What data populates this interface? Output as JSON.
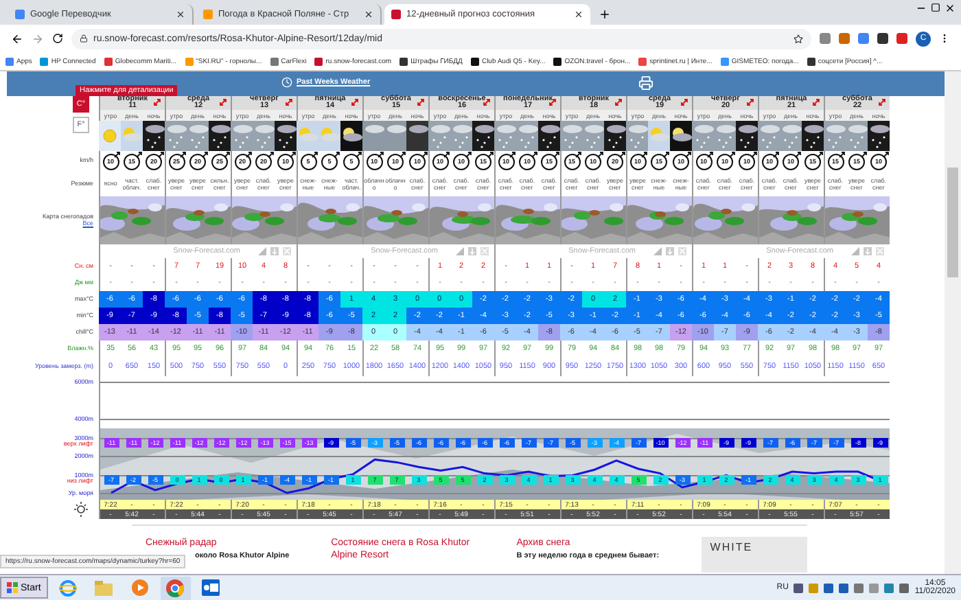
{
  "browser": {
    "tabs": [
      {
        "title": "Google Переводчик",
        "selected": false
      },
      {
        "title": "Погода в Красной Поляне - Стр",
        "selected": false
      },
      {
        "title": "12-дневный прогноз состояния",
        "selected": true
      }
    ],
    "url": "ru.snow-forecast.com/resorts/Rosa-Khutor-Alpine-Resort/12day/mid",
    "profile": "C",
    "bookmarks": [
      "Apps",
      "HP Connected",
      "Globecomm Mariti...",
      "\"SKI.RU\" - горнолы...",
      "CarFlexi",
      "ru.snow-forecast.com",
      "Штрафы ГИБДД",
      "Club Audi Q5 - Key...",
      "OZON.travel - брон...",
      "sprintinet.ru | Инте...",
      "GISMETEO: погода...",
      "соцсети [Россия] ^..."
    ]
  },
  "header": {
    "tooltip": "Нажмите для детализации",
    "past_weather_link": "Past Weeks Weather"
  },
  "units": [
    {
      "label": "C°",
      "selected": true
    },
    {
      "label": "F°",
      "selected": false
    }
  ],
  "row_labels": {
    "wind": "km/h",
    "summary": "Резюме",
    "maps": "Карта снегопадов",
    "maps_link": "Все",
    "snow": "Сн. см",
    "rain": "Дж мм",
    "max": "max°C",
    "min": "min°C",
    "chill": "chill°C",
    "humidity": "Влажн.%",
    "freezing": "Уровень замерз. (m)"
  },
  "strips": [
    "Snow-Forecast.com",
    "Snow-Forecast.com",
    "Snow-Forecast.com",
    "Snow-Forecast.com"
  ],
  "days": [
    {
      "name": "вторник",
      "date": "11",
      "sunrise": [
        "7:22",
        "-",
        "-"
      ],
      "sunset": [
        "-",
        "5:42",
        "-"
      ],
      "columns": [
        {
          "period": "утро",
          "kind": "sun",
          "wind": "10",
          "summary": "ясно",
          "snow": "-",
          "rain": "-",
          "max": "-6",
          "min": "-9",
          "chill": "-13",
          "humidity": "35",
          "freezing": "0",
          "top_lift": "-11",
          "bottom_lift": "-7"
        },
        {
          "period": "день",
          "kind": "part_sun",
          "wind": "15",
          "summary": "част. облач.",
          "snow": "-",
          "rain": "-",
          "max": "-6",
          "min": "-7",
          "chill": "-11",
          "humidity": "56",
          "freezing": "650",
          "top_lift": "-11",
          "bottom_lift": "-2"
        },
        {
          "period": "ночь",
          "kind": "night_snow",
          "wind": "20",
          "summary": "слаб. снег",
          "snow": "-",
          "rain": "-",
          "max": "-8",
          "min": "-9",
          "chill": "-14",
          "humidity": "43",
          "freezing": "150",
          "top_lift": "-12",
          "bottom_lift": "-5"
        }
      ]
    },
    {
      "name": "среда",
      "date": "12",
      "sunrise": [
        "7:22",
        "-",
        "-"
      ],
      "sunset": [
        "-",
        "5:44",
        "-"
      ],
      "columns": [
        {
          "period": "утро",
          "kind": "snow",
          "wind": "25",
          "summary": "увере снег",
          "snow": "7",
          "rain": "-",
          "max": "-6",
          "min": "-8",
          "chill": "-12",
          "humidity": "95",
          "freezing": "500",
          "top_lift": "-11",
          "bottom_lift": "0"
        },
        {
          "period": "день",
          "kind": "snow",
          "wind": "20",
          "summary": "увере снег",
          "snow": "7",
          "rain": "-",
          "max": "-6",
          "min": "-5",
          "chill": "-11",
          "humidity": "95",
          "freezing": "750",
          "top_lift": "-12",
          "bottom_lift": "1"
        },
        {
          "period": "ночь",
          "kind": "night_snow",
          "wind": "25",
          "summary": "сильн. снег",
          "snow": "19",
          "rain": "-",
          "max": "-6",
          "min": "-8",
          "chill": "-11",
          "humidity": "96",
          "freezing": "550",
          "top_lift": "-12",
          "bottom_lift": "0"
        }
      ]
    },
    {
      "name": "четверг",
      "date": "13",
      "sunrise": [
        "7:20",
        "-",
        "-"
      ],
      "sunset": [
        "-",
        "5:45",
        "-"
      ],
      "columns": [
        {
          "period": "утро",
          "kind": "snow",
          "wind": "20",
          "summary": "увере снег",
          "snow": "10",
          "rain": "-",
          "max": "-6",
          "min": "-5",
          "chill": "-10",
          "humidity": "97",
          "freezing": "750",
          "top_lift": "-12",
          "bottom_lift": "1"
        },
        {
          "period": "день",
          "kind": "snow",
          "wind": "20",
          "summary": "слаб. снег",
          "snow": "4",
          "rain": "-",
          "max": "-8",
          "min": "-7",
          "chill": "-11",
          "humidity": "84",
          "freezing": "550",
          "top_lift": "-13",
          "bottom_lift": "-1"
        },
        {
          "period": "ночь",
          "kind": "night_snow",
          "wind": "10",
          "summary": "увере снег",
          "snow": "8",
          "rain": "-",
          "max": "-8",
          "min": "-9",
          "chill": "-12",
          "humidity": "94",
          "freezing": "0",
          "top_lift": "-15",
          "bottom_lift": "-4"
        }
      ]
    },
    {
      "name": "пятница",
      "date": "14",
      "sunrise": [
        "7:18",
        "-",
        "-"
      ],
      "sunset": [
        "-",
        "5:45",
        "-"
      ],
      "columns": [
        {
          "period": "утро",
          "kind": "part_sun",
          "wind": "5",
          "summary": "снеж- ные",
          "snow": "-",
          "rain": "-",
          "max": "-8",
          "min": "-8",
          "chill": "-11",
          "humidity": "94",
          "freezing": "250",
          "top_lift": "-13",
          "bottom_lift": "-1"
        },
        {
          "period": "день",
          "kind": "part_sun",
          "wind": "5",
          "summary": "снеж- ные",
          "snow": "-",
          "rain": "-",
          "max": "-6",
          "min": "-6",
          "chill": "-9",
          "humidity": "76",
          "freezing": "750",
          "top_lift": "-9",
          "bottom_lift": "-1"
        },
        {
          "period": "ночь",
          "kind": "night_moon",
          "wind": "5",
          "summary": "част. облач.",
          "snow": "-",
          "rain": "-",
          "max": "1",
          "min": "-5",
          "chill": "-8",
          "humidity": "15",
          "freezing": "1000",
          "top_lift": "-5",
          "bottom_lift": "1"
        }
      ]
    },
    {
      "name": "суббота",
      "date": "15",
      "sunrise": [
        "7:18",
        "-",
        "-"
      ],
      "sunset": [
        "-",
        "5:47",
        "-"
      ],
      "columns": [
        {
          "period": "утро",
          "kind": "overcast",
          "wind": "10",
          "summary": "облачн о",
          "snow": "-",
          "rain": "-",
          "max": "4",
          "min": "2",
          "chill": "0",
          "humidity": "22",
          "freezing": "1800",
          "top_lift": "-3",
          "bottom_lift": "7"
        },
        {
          "period": "день",
          "kind": "overcast",
          "wind": "10",
          "summary": "облачн о",
          "snow": "-",
          "rain": "-",
          "max": "3",
          "min": "2",
          "chill": "0",
          "humidity": "58",
          "freezing": "1650",
          "top_lift": "-5",
          "bottom_lift": "7"
        },
        {
          "period": "ночь",
          "kind": "night_overcast",
          "wind": "10",
          "summary": "слаб. снег",
          "snow": "-",
          "rain": "-",
          "max": "0",
          "min": "-2",
          "chill": "-4",
          "humidity": "74",
          "freezing": "1400",
          "top_lift": "-6",
          "bottom_lift": "3"
        }
      ]
    },
    {
      "name": "воскресенье",
      "date": "16",
      "sunrise": [
        "7:16",
        "-",
        "-"
      ],
      "sunset": [
        "-",
        "5:49",
        "-"
      ],
      "columns": [
        {
          "period": "утро",
          "kind": "snow",
          "wind": "10",
          "summary": "слаб. снег",
          "snow": "1",
          "rain": "-",
          "max": "0",
          "min": "-2",
          "chill": "-4",
          "humidity": "95",
          "freezing": "1200",
          "top_lift": "-6",
          "bottom_lift": "5"
        },
        {
          "period": "день",
          "kind": "snow",
          "wind": "10",
          "summary": "слаб. снег",
          "snow": "2",
          "rain": "-",
          "max": "0",
          "min": "-1",
          "chill": "-1",
          "humidity": "99",
          "freezing": "1400",
          "top_lift": "-6",
          "bottom_lift": "5"
        },
        {
          "period": "ночь",
          "kind": "night_snow",
          "wind": "15",
          "summary": "слаб. снег",
          "snow": "2",
          "rain": "-",
          "max": "-2",
          "min": "-4",
          "chill": "-6",
          "humidity": "97",
          "freezing": "1050",
          "top_lift": "-6",
          "bottom_lift": "2"
        }
      ]
    },
    {
      "name": "понедельник",
      "date": "17",
      "sunrise": [
        "7:15",
        "-",
        "-"
      ],
      "sunset": [
        "-",
        "5:51",
        "-"
      ],
      "columns": [
        {
          "period": "утро",
          "kind": "snow",
          "wind": "10",
          "summary": "слаб. снег",
          "snow": "-",
          "rain": "-",
          "max": "-2",
          "min": "-3",
          "chill": "-5",
          "humidity": "92",
          "freezing": "950",
          "top_lift": "-6",
          "bottom_lift": "3"
        },
        {
          "period": "день",
          "kind": "snow",
          "wind": "10",
          "summary": "слаб. снег",
          "snow": "1",
          "rain": "-",
          "max": "-2",
          "min": "-2",
          "chill": "-4",
          "humidity": "97",
          "freezing": "1150",
          "top_lift": "-7",
          "bottom_lift": "4"
        },
        {
          "period": "ночь",
          "kind": "night_snow",
          "wind": "15",
          "summary": "слаб. снег",
          "snow": "1",
          "rain": "-",
          "max": "-3",
          "min": "-5",
          "chill": "-8",
          "humidity": "99",
          "freezing": "900",
          "top_lift": "-7",
          "bottom_lift": "1"
        }
      ]
    },
    {
      "name": "вторник",
      "date": "18",
      "sunrise": [
        "7:13",
        "-",
        "-"
      ],
      "sunset": [
        "-",
        "5:52",
        "-"
      ],
      "columns": [
        {
          "period": "утро",
          "kind": "snow",
          "wind": "15",
          "summary": "слаб. снег",
          "snow": "-",
          "rain": "-",
          "max": "-2",
          "min": "-3",
          "chill": "-6",
          "humidity": "79",
          "freezing": "950",
          "top_lift": "-5",
          "bottom_lift": "3"
        },
        {
          "period": "день",
          "kind": "snow",
          "wind": "10",
          "summary": "слаб. снег",
          "snow": "1",
          "rain": "-",
          "max": "0",
          "min": "-1",
          "chill": "-4",
          "humidity": "94",
          "freezing": "1250",
          "top_lift": "-3",
          "bottom_lift": "4"
        },
        {
          "period": "ночь",
          "kind": "night_snow",
          "wind": "20",
          "summary": "увере снег",
          "snow": "7",
          "rain": "-",
          "max": "2",
          "min": "-2",
          "chill": "-6",
          "humidity": "84",
          "freezing": "1750",
          "top_lift": "-4",
          "bottom_lift": "4"
        }
      ]
    },
    {
      "name": "среда",
      "date": "19",
      "sunrise": [
        "7:11",
        "-",
        "-"
      ],
      "sunset": [
        "-",
        "5:52",
        "-"
      ],
      "columns": [
        {
          "period": "утро",
          "kind": "snow",
          "wind": "10",
          "summary": "увере снег",
          "snow": "8",
          "rain": "-",
          "max": "-1",
          "min": "-1",
          "chill": "-5",
          "humidity": "98",
          "freezing": "1300",
          "top_lift": "-7",
          "bottom_lift": "5"
        },
        {
          "period": "день",
          "kind": "part_sun",
          "wind": "15",
          "summary": "снеж- ные",
          "snow": "1",
          "rain": "-",
          "max": "-3",
          "min": "-4",
          "chill": "-7",
          "humidity": "98",
          "freezing": "1050",
          "top_lift": "-10",
          "bottom_lift": "2"
        },
        {
          "period": "ночь",
          "kind": "night_moon",
          "wind": "10",
          "summary": "снеж- ные",
          "snow": "-",
          "rain": "-",
          "max": "-6",
          "min": "-6",
          "chill": "-12",
          "humidity": "79",
          "freezing": "300",
          "top_lift": "-12",
          "bottom_lift": "-3"
        }
      ]
    },
    {
      "name": "четверг",
      "date": "20",
      "sunrise": [
        "7:09",
        "-",
        "-"
      ],
      "sunset": [
        "-",
        "5:54",
        "-"
      ],
      "columns": [
        {
          "period": "утро",
          "kind": "snow",
          "wind": "10",
          "summary": "слаб. снег",
          "snow": "1",
          "rain": "-",
          "max": "-4",
          "min": "-6",
          "chill": "-10",
          "humidity": "94",
          "freezing": "600",
          "top_lift": "-11",
          "bottom_lift": "1"
        },
        {
          "period": "день",
          "kind": "snow",
          "wind": "10",
          "summary": "слаб. снег",
          "snow": "1",
          "rain": "-",
          "max": "-3",
          "min": "-4",
          "chill": "-7",
          "humidity": "93",
          "freezing": "950",
          "top_lift": "-9",
          "bottom_lift": "2"
        },
        {
          "period": "ночь",
          "kind": "night_snow",
          "wind": "10",
          "summary": "слаб. снег",
          "snow": "-",
          "rain": "-",
          "max": "-4",
          "min": "-6",
          "chill": "-9",
          "humidity": "77",
          "freezing": "550",
          "top_lift": "-9",
          "bottom_lift": "-1"
        }
      ]
    },
    {
      "name": "пятница",
      "date": "21",
      "sunrise": [
        "7:09",
        "-",
        "-"
      ],
      "sunset": [
        "-",
        "5:55",
        "-"
      ],
      "columns": [
        {
          "period": "утро",
          "kind": "snow",
          "wind": "10",
          "summary": "слаб. снег",
          "snow": "2",
          "rain": "-",
          "max": "-3",
          "min": "-4",
          "chill": "-6",
          "humidity": "92",
          "freezing": "750",
          "top_lift": "-7",
          "bottom_lift": "2"
        },
        {
          "period": "день",
          "kind": "snow",
          "wind": "10",
          "summary": "слаб. снег",
          "snow": "3",
          "rain": "-",
          "max": "-1",
          "min": "-2",
          "chill": "-2",
          "humidity": "97",
          "freezing": "1150",
          "top_lift": "-6",
          "bottom_lift": "4"
        },
        {
          "period": "ночь",
          "kind": "night_snow",
          "wind": "15",
          "summary": "увере снег",
          "snow": "8",
          "rain": "-",
          "max": "-2",
          "min": "-2",
          "chill": "-4",
          "humidity": "98",
          "freezing": "1050",
          "top_lift": "-7",
          "bottom_lift": "3"
        }
      ]
    },
    {
      "name": "суббота",
      "date": "22",
      "sunrise": [
        "7:07",
        "-",
        "-"
      ],
      "sunset": [
        "-",
        "5:57",
        "-"
      ],
      "columns": [
        {
          "period": "утро",
          "kind": "snow",
          "wind": "15",
          "summary": "слаб. снег",
          "snow": "4",
          "rain": "-",
          "max": "-2",
          "min": "-2",
          "chill": "-4",
          "humidity": "98",
          "freezing": "1150",
          "top_lift": "-7",
          "bottom_lift": "4"
        },
        {
          "period": "день",
          "kind": "snow",
          "wind": "15",
          "summary": "увере снег",
          "snow": "5",
          "rain": "-",
          "max": "-2",
          "min": "-3",
          "chill": "-3",
          "humidity": "97",
          "freezing": "1150",
          "top_lift": "-8",
          "bottom_lift": "3"
        },
        {
          "period": "ночь",
          "kind": "night_snow",
          "wind": "10",
          "summary": "слаб. снег",
          "snow": "4",
          "rain": "-",
          "max": "-4",
          "min": "-5",
          "chill": "-8",
          "humidity": "97",
          "freezing": "650",
          "top_lift": "-9",
          "bottom_lift": "1"
        }
      ]
    }
  ],
  "chart": {
    "top_lift_label": "верх лифт",
    "bottom_lift_label": "низ лифт",
    "chart_data": {
      "type": "line",
      "ylim": [
        0,
        6000
      ],
      "yticks": [
        {
          "value": 0,
          "label": "Ур. моря"
        },
        {
          "value": 1000,
          "label": "1000m"
        },
        {
          "value": 2000,
          "label": "2000m"
        },
        {
          "value": 3000,
          "label": "3000m"
        },
        {
          "value": 4000,
          "label": "4000m"
        },
        {
          "value": 6000,
          "label": "6000m"
        }
      ],
      "series": [
        {
          "color": "#1515e0",
          "values": [
            0,
            650,
            150,
            500,
            750,
            550,
            750,
            550,
            0,
            250,
            750,
            1000,
            1800,
            1650,
            1400,
            1200,
            1400,
            1050,
            950,
            1150,
            900,
            950,
            1250,
            1750,
            1300,
            1050,
            300,
            600,
            950,
            550,
            750,
            1150,
            1050,
            1150,
            1150,
            650
          ]
        }
      ]
    }
  },
  "footer": {
    "sections": [
      {
        "title": "Снежный радар",
        "text": "около Rosa Khutor Alpine"
      },
      {
        "title": "Состояние снега в Rosa Khutor Alpine Resort"
      },
      {
        "title": "Архив снега",
        "text": "В эту неделю года в среднем бывает:"
      }
    ],
    "ad": "WHITE"
  },
  "status_url": "https://ru.snow-forecast.com/maps/dynamic/turkey?hr=60",
  "taskbar": {
    "start": "Start",
    "language": "RU",
    "time": "14:05",
    "date": "11/02/2020"
  }
}
